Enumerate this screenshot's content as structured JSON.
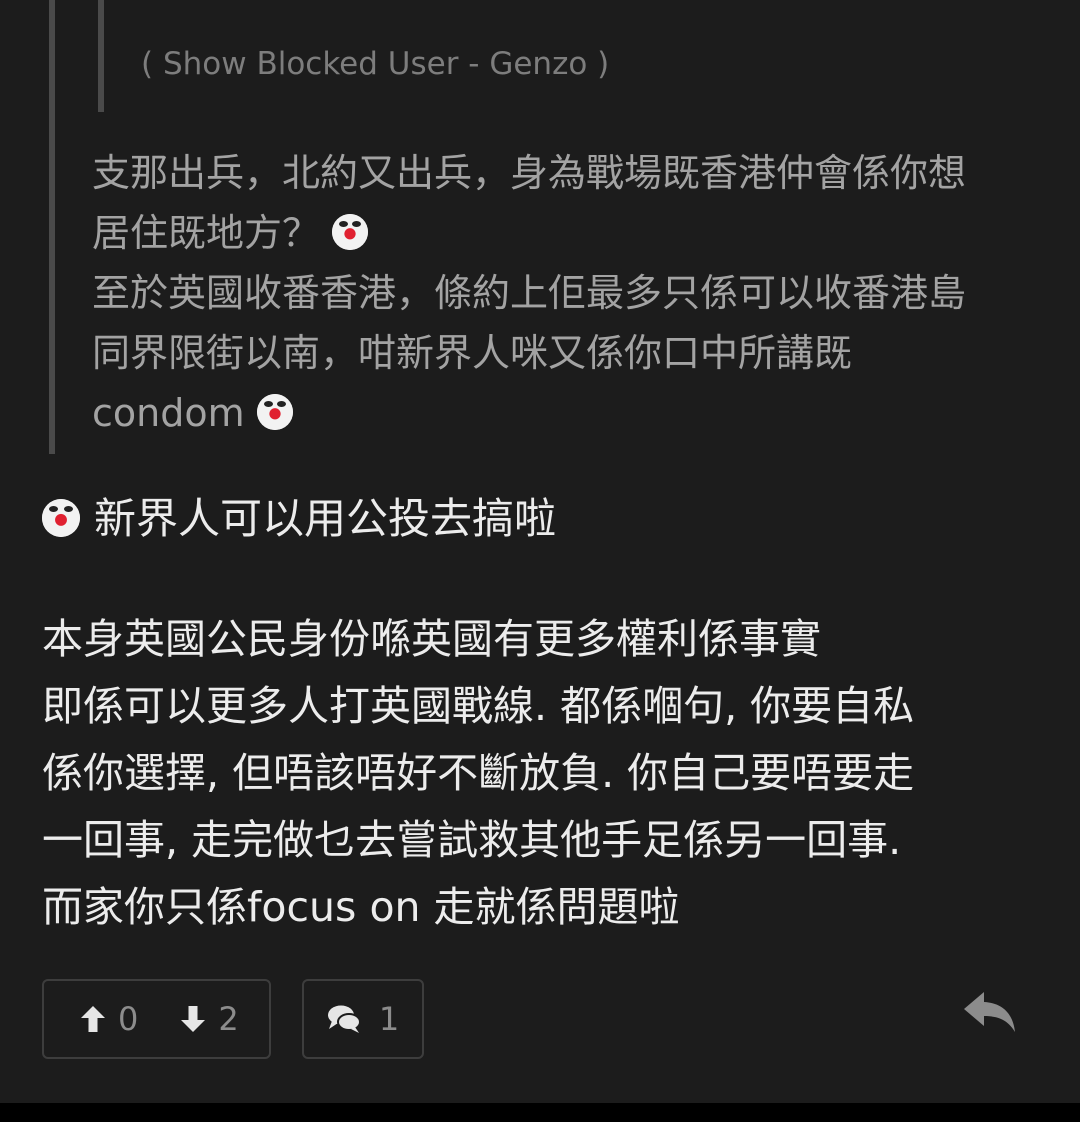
{
  "quote": {
    "blocked_label": "( Show Blocked User - Genzo )",
    "lines": [
      "支那出兵，北約又出兵，身為戰場既香港仲會係你想",
      "居住既地方？",
      "至於英國收番香港，條約上佢最多只係可以收番港島",
      "同界限街以南，咁新界人咪又係你口中所講既",
      "condom"
    ]
  },
  "post": {
    "headline": "新界人可以用公投去搞啦",
    "lines": [
      "本身英國公民身份喺英國有更多權利係事實",
      "即係可以更多人打英國戰線. 都係嗰句, 你要自私",
      "係你選擇, 但唔該唔好不斷放負. 你自己要唔要走",
      "一回事, 走完做乜去嘗試救其他手足係另一回事.",
      "而家你只係focus on 走就係問題啦"
    ]
  },
  "actions": {
    "upvotes": "0",
    "downvotes": "2",
    "comments": "1"
  },
  "icons": {
    "emoji": "clown-face-icon",
    "upvote": "arrow-up-icon",
    "downvote": "arrow-down-icon",
    "comment": "comment-bubbles-icon",
    "reply": "reply-icon"
  },
  "colors": {
    "background": "#1c1c1c",
    "quote_text": "#a3a3a3",
    "body_text": "#ececec",
    "muted": "#8c8c8c",
    "emoji_red": "#e02030"
  }
}
